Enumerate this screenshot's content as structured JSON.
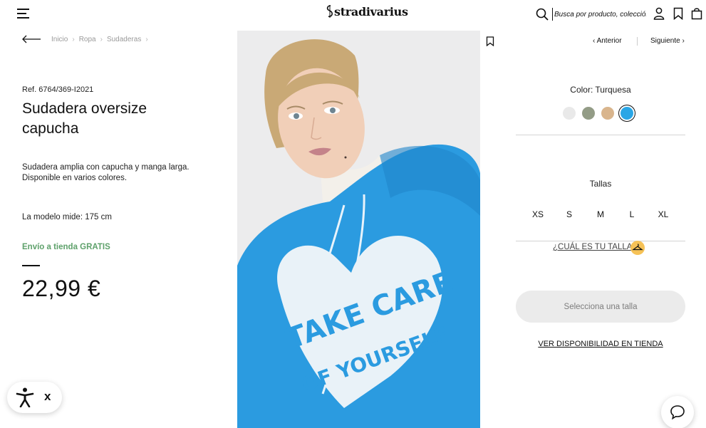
{
  "header": {
    "logo_text": "stradivarius",
    "search_placeholder": "Busca por producto, colección...",
    "icons": [
      "menu-icon",
      "search-icon",
      "user-icon",
      "bookmark-icon",
      "bag-icon"
    ]
  },
  "breadcrumb": [
    "Inicio",
    "Ropa",
    "Sudaderas"
  ],
  "product": {
    "ref": "Ref. 6764/369-I2021",
    "title": "Sudadera oversize capucha",
    "description": "Sudadera amplia con capucha y manga larga. Disponible en varios colores.",
    "model_info": "La modelo mide: 175 cm",
    "shipping": "Envío a tienda GRATIS",
    "price": "22,99 €",
    "image_print_text": "TAKE CARE OF YOURSELF"
  },
  "nav": {
    "prev": "Anterior",
    "next": "Siguiente"
  },
  "colors": {
    "label": "Color: Turquesa",
    "swatches": [
      {
        "name": "Blanco",
        "hex": "#e9e9e9",
        "selected": false
      },
      {
        "name": "Verde",
        "hex": "#939c86",
        "selected": false
      },
      {
        "name": "Beige",
        "hex": "#d9b58d",
        "selected": false
      },
      {
        "name": "Turquesa",
        "hex": "#29a6e6",
        "selected": true
      }
    ]
  },
  "sizes": {
    "title": "Tallas",
    "options": [
      "XS",
      "S",
      "M",
      "L",
      "XL"
    ]
  },
  "size_guide": "¿CUÁL ES TU TALLA?",
  "cta": {
    "select_size": "Selecciona una talla",
    "store_availability": "VER DISPONIBILIDAD EN TIENDA"
  },
  "accessibility": {
    "close_label": "x"
  },
  "theme": {
    "accent_green": "#5ea16b",
    "hoodie_blue": "#2b9be0",
    "size_guide_badge": "#f6c257"
  }
}
